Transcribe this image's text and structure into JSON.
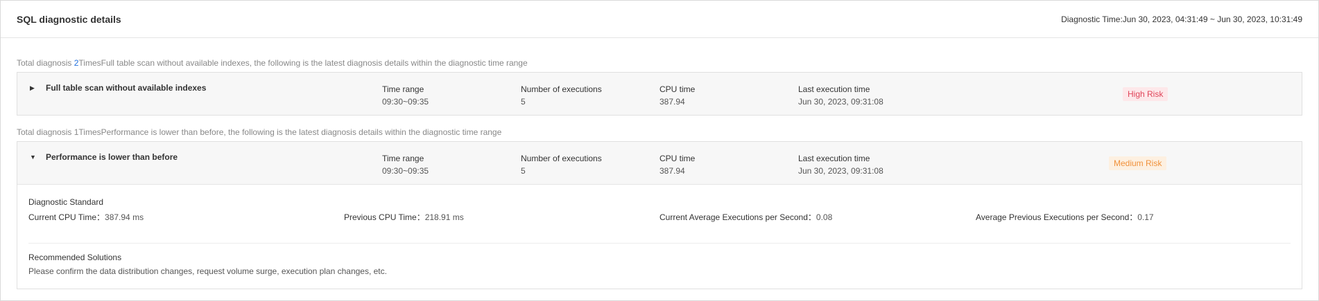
{
  "header": {
    "title": "SQL diagnostic details",
    "diagnostic_time": "Diagnostic Time:Jun 30, 2023, 04:31:49 ~ Jun 30, 2023, 10:31:49"
  },
  "groups": [
    {
      "summary_prefix": "Total diagnosis ",
      "count": "2",
      "summary_suffix": "TimesFull table scan without available indexes, the following is the latest diagnosis details within the diagnostic time range",
      "item": {
        "expanded": false,
        "arrow": "▶",
        "name": "Full table scan without available indexes",
        "time_range_label": "Time range",
        "time_range": "09:30~09:35",
        "executions_label": "Number of executions",
        "executions": "5",
        "cpu_label": "CPU time",
        "cpu": "387.94",
        "last_exec_label": "Last execution time",
        "last_exec": "Jun 30, 2023, 09:31:08",
        "risk": "High Risk"
      }
    },
    {
      "summary_prefix": "Total diagnosis ",
      "count": "1",
      "summary_suffix": "TimesPerformance is lower than before, the following is the latest diagnosis details within the diagnostic time range",
      "item": {
        "expanded": true,
        "arrow": "▼",
        "name": "Performance is lower than before",
        "time_range_label": "Time range",
        "time_range": "09:30~09:35",
        "executions_label": "Number of executions",
        "executions": "5",
        "cpu_label": "CPU time",
        "cpu": "387.94",
        "last_exec_label": "Last execution time",
        "last_exec": "Jun 30, 2023, 09:31:08",
        "risk": "Medium Risk",
        "detail": {
          "standard_title": "Diagnostic Standard",
          "metrics": [
            {
              "label": "Current CPU Time：",
              "value": "387.94 ms"
            },
            {
              "label": "Previous CPU Time：",
              "value": "218.91 ms"
            },
            {
              "label": "Current Average Executions per Second：",
              "value": "0.08"
            },
            {
              "label": "Average Previous Executions per Second：",
              "value": "0.17"
            }
          ],
          "solutions_title": "Recommended Solutions",
          "solutions": "Please confirm the data distribution changes, request volume surge, execution plan changes, etc."
        }
      }
    }
  ],
  "colors": {
    "link": "#1f6fde",
    "high_risk_bg": "#fde8ea",
    "high_risk_text": "#e0465a",
    "medium_risk_bg": "#fdf0e1",
    "medium_risk_text": "#f0913a"
  }
}
